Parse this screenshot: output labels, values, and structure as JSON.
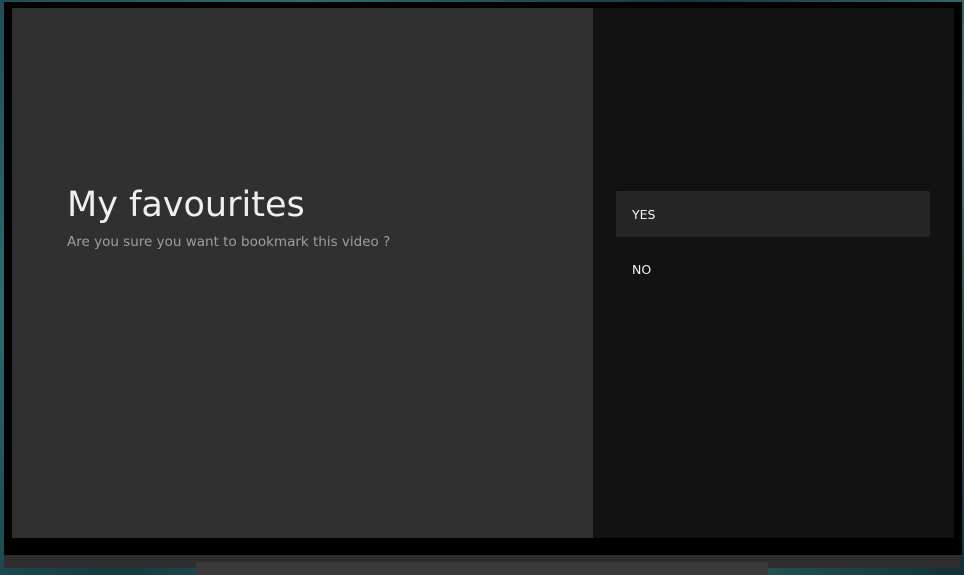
{
  "dialog": {
    "title": "My favourites",
    "description": "Are you sure you want to bookmark this video ?",
    "actions": [
      {
        "label": "YES",
        "selected": true
      },
      {
        "label": "NO",
        "selected": false
      }
    ]
  },
  "colors": {
    "guidance_background": "#303030",
    "actions_background": "#121212",
    "selected_action_background": "#262626",
    "title_text": "#efefef",
    "description_text": "#9e9e9e"
  }
}
